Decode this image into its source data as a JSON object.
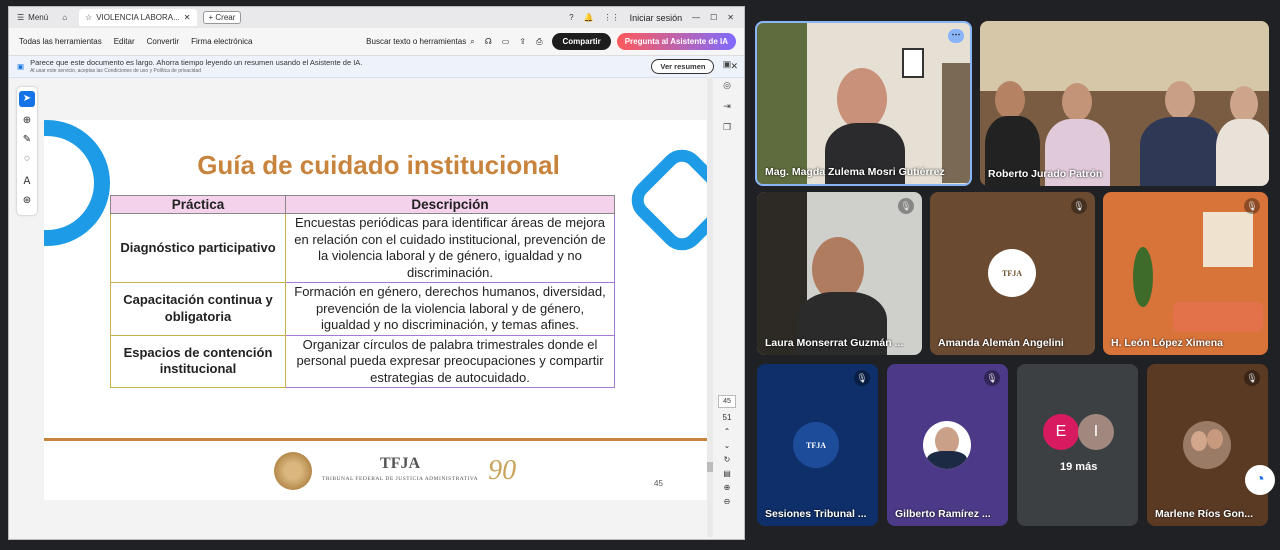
{
  "browser": {
    "menu_label": "Menú",
    "tab_title": "VIOLENCIA LABORA...",
    "new_label": "+ Crear",
    "sign_in": "Iniciar sesión"
  },
  "toolbar": {
    "items": [
      "Todas las herramientas",
      "Editar",
      "Convertir",
      "Firma electrónica"
    ],
    "search_placeholder": "Buscar texto o herramientas",
    "share_label": "Compartir",
    "ask_label": "Pregunta al Asistente de IA"
  },
  "banner": {
    "text": "Parece que este documento es largo. Ahorra tiempo leyendo un resumen usando el Asistente de IA.",
    "small_text": "Al usar este servicio, aceptas las Condiciones de uso y Política de privacidad",
    "button_label": "Ver resumen"
  },
  "slide": {
    "title": "Guía de cuidado institucional",
    "table": {
      "headers": [
        "Práctica",
        "Descripción"
      ],
      "rows": [
        {
          "practice": "Diagnóstico participativo",
          "description": "Encuestas periódicas para identificar áreas de mejora en relación con el cuidado institucional, prevención de la violencia laboral y de género, igualdad y no discriminación."
        },
        {
          "practice": "Capacitación continua y obligatoria",
          "description": "Formación en género, derechos humanos, diversidad, prevención de la violencia laboral y de género, igualdad y no discriminación, y temas afines."
        },
        {
          "practice": "Espacios de contención institucional",
          "description": "Organizar círculos de palabra trimestrales donde el personal pueda expresar preocupaciones y compartir estrategias de autocuidado."
        }
      ]
    },
    "footer_logo": "TFJA",
    "footer_logo_sub": "TRIBUNAL FEDERAL DE JUSTICIA ADMINISTRATIVA",
    "page_number": "45"
  },
  "page_controls": {
    "current": "45",
    "total": "51"
  },
  "participants": [
    {
      "name": "Mag. Magda Zulema Mosri Gutiérrez"
    },
    {
      "name": "Roberto Jurado Patrón"
    },
    {
      "name": "Laura Monserrat Guzmán ..."
    },
    {
      "name": "Amanda Alemán Angelini"
    },
    {
      "name": "H. León López Ximena"
    },
    {
      "name": "Sesiones Tribunal ..."
    },
    {
      "name": "Gilberto Ramírez ..."
    },
    {
      "name": "Marlene Ríos Gon..."
    }
  ],
  "others": {
    "avatar1": "E",
    "avatar2": "I",
    "more_label": "19 más"
  },
  "colors": {
    "accent": "#1e9be6",
    "title": "#c8843c",
    "header": "#f5d2ec"
  }
}
